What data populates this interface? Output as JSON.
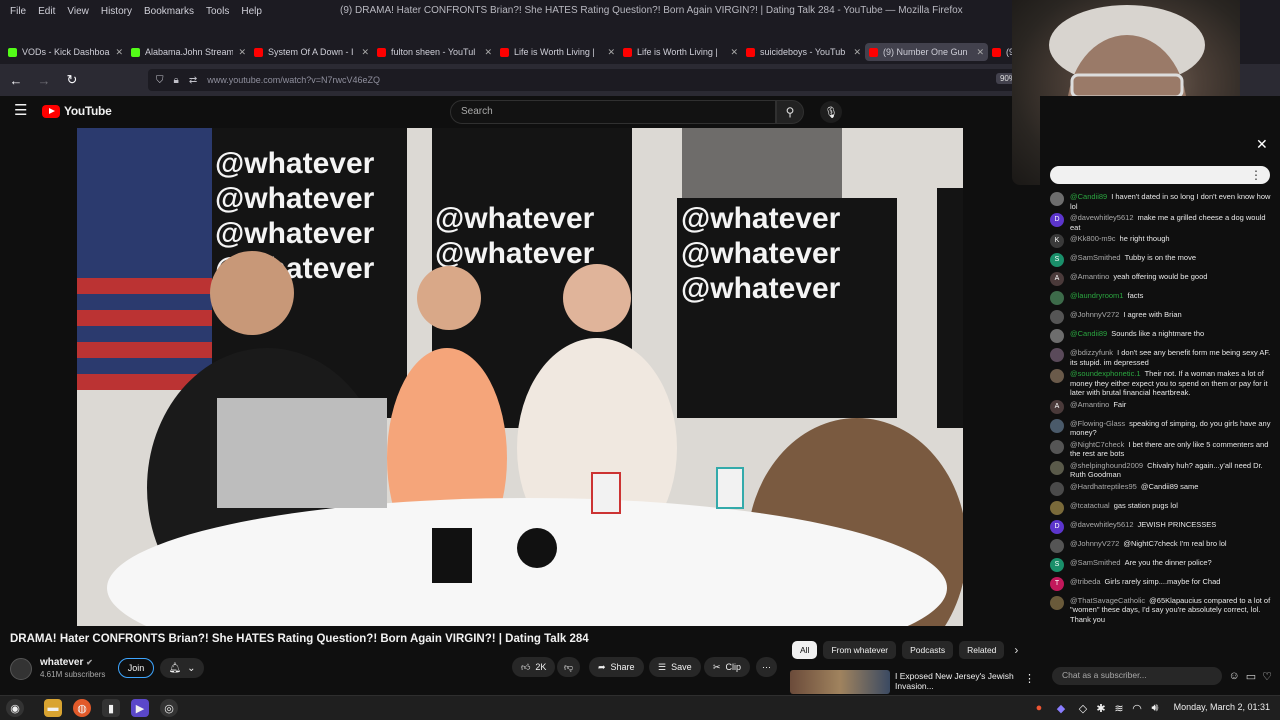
{
  "browser": {
    "window_title": "(9) DRAMA! Hater CONFRONTS Brian?! She HATES Rating Question?! Born Again VIRGIN?! | Dating Talk 284 - YouTube — Mozilla Firefox",
    "menus": [
      "File",
      "Edit",
      "View",
      "History",
      "Bookmarks",
      "Tools",
      "Help"
    ],
    "tabs": [
      {
        "label": "VODs - Kick Dashboa",
        "color": "#53fc18"
      },
      {
        "label": "Alabama.John Stream",
        "color": "#53fc18"
      },
      {
        "label": "System Of A Down - I",
        "color": "#ff0000"
      },
      {
        "label": "fulton sheen - YouTul",
        "color": "#ff0000"
      },
      {
        "label": "Life is Worth Living | ",
        "color": "#ff0000"
      },
      {
        "label": "Life is Worth Living | ",
        "color": "#ff0000"
      },
      {
        "label": "suicideboys - YouTub",
        "color": "#ff0000"
      },
      {
        "label": "(9) Number One Gun",
        "color": "#ff0000"
      },
      {
        "label": "(9",
        "color": "#ff0000"
      }
    ],
    "url": "www.youtube.com/watch?v=N7rwcV46eZQ",
    "zoom": "90%"
  },
  "youtube": {
    "logo_text": "YouTube",
    "search_placeholder": "Search",
    "video_title": "DRAMA! Hater CONFRONTS Brian?! She HATES Rating Question?! Born Again VIRGIN?! | Dating Talk 284",
    "watermark": "@whatever",
    "channel": {
      "name": "whatever",
      "subscribers": "4.61M subscribers",
      "join": "Join"
    },
    "actions": {
      "likes": "2K",
      "share": "Share",
      "save": "Save",
      "clip": "Clip"
    },
    "chips": [
      "All",
      "From whatever",
      "Podcasts",
      "Related"
    ],
    "recommended_title": "I Exposed New Jersey's Jewish Invasion..."
  },
  "chat": {
    "input_placeholder": "Chat as a subscriber...",
    "messages": [
      {
        "author": "@Candii89",
        "text": "I haven't dated in so long I don't even know how lol",
        "color": "#6d6d6d",
        "initial": "",
        "member": true
      },
      {
        "author": "@davewhitley5612",
        "text": "make me a grilled cheese a dog would eat",
        "color": "#5c35cc",
        "initial": "D",
        "member": false
      },
      {
        "author": "@Kk800-m9c",
        "text": "he right though",
        "color": "#3a3a3a",
        "initial": "K",
        "member": false
      },
      {
        "author": "@SamSmithed",
        "text": "Tubby is on the move",
        "color": "#1a8f6a",
        "initial": "S",
        "member": false
      },
      {
        "author": "@Amantino",
        "text": "yeah offering would be good",
        "color": "#4a3a3a",
        "initial": "A",
        "member": false
      },
      {
        "author": "@laundryroom1",
        "text": "facts",
        "color": "#3d6b4a",
        "initial": "",
        "member": true
      },
      {
        "author": "@JohnnyV272",
        "text": "I agree with Brian",
        "color": "#555",
        "initial": "",
        "member": false
      },
      {
        "author": "@Candii89",
        "text": "Sounds like a nightmare tho",
        "color": "#6d6d6d",
        "initial": "",
        "member": true
      },
      {
        "author": "@bdizzyfunk",
        "text": "I don't see any benefit form me being sexy AF. its stupid. im depressed",
        "color": "#5a4a5a",
        "initial": "",
        "member": false
      },
      {
        "author": "@soundexphonetic.1",
        "text": "Their not. If a woman makes a lot of money they either expect you to spend on them or pay for it later with brutal financial heartbreak.",
        "color": "#6a5a4a",
        "initial": "",
        "member": true
      },
      {
        "author": "@Amantino",
        "text": "Fair",
        "color": "#4a3a3a",
        "initial": "A",
        "member": false
      },
      {
        "author": "@Flowing-Glass",
        "text": "speaking of simping, do you girls have any money?",
        "color": "#4a5a6a",
        "initial": "",
        "member": false
      },
      {
        "author": "@NightC7check",
        "text": "I bet there are only like 5 commenters and the rest are bots",
        "color": "#555",
        "initial": "",
        "member": false
      },
      {
        "author": "@shelpinghound2009",
        "text": "Chivalry huh? again...y'all need Dr. Ruth Goodman",
        "color": "#5a5a4a",
        "initial": "",
        "member": false
      },
      {
        "author": "@Hardhatreptiles95",
        "text": "@Candii89 same",
        "color": "#4a4a4a",
        "initial": "",
        "member": false
      },
      {
        "author": "@tcatactual",
        "text": "gas station pugs lol",
        "color": "#7a6a3a",
        "initial": "",
        "member": false
      },
      {
        "author": "@davewhitley5612",
        "text": "JEWISH PRINCESSES",
        "color": "#5c35cc",
        "initial": "D",
        "member": false
      },
      {
        "author": "@JohnnyV272",
        "text": "@NightC7check I'm real bro lol",
        "color": "#555",
        "initial": "",
        "member": false
      },
      {
        "author": "@SamSmithed",
        "text": "Are you the dinner police?",
        "color": "#1a8f6a",
        "initial": "S",
        "member": false
      },
      {
        "author": "@tribeda",
        "text": "Girls rarely simp....maybe for Chad",
        "color": "#c2185b",
        "initial": "T",
        "member": false
      },
      {
        "author": "@ThatSavageCatholic",
        "text": "@65Klapaucius compared to a lot of \"women\" these days, I'd say you're absolutely correct, lol. Thank you",
        "color": "#6a5a3a",
        "initial": "",
        "member": false
      }
    ]
  },
  "taskbar": {
    "clock": "Monday, March  2, 01:31"
  }
}
